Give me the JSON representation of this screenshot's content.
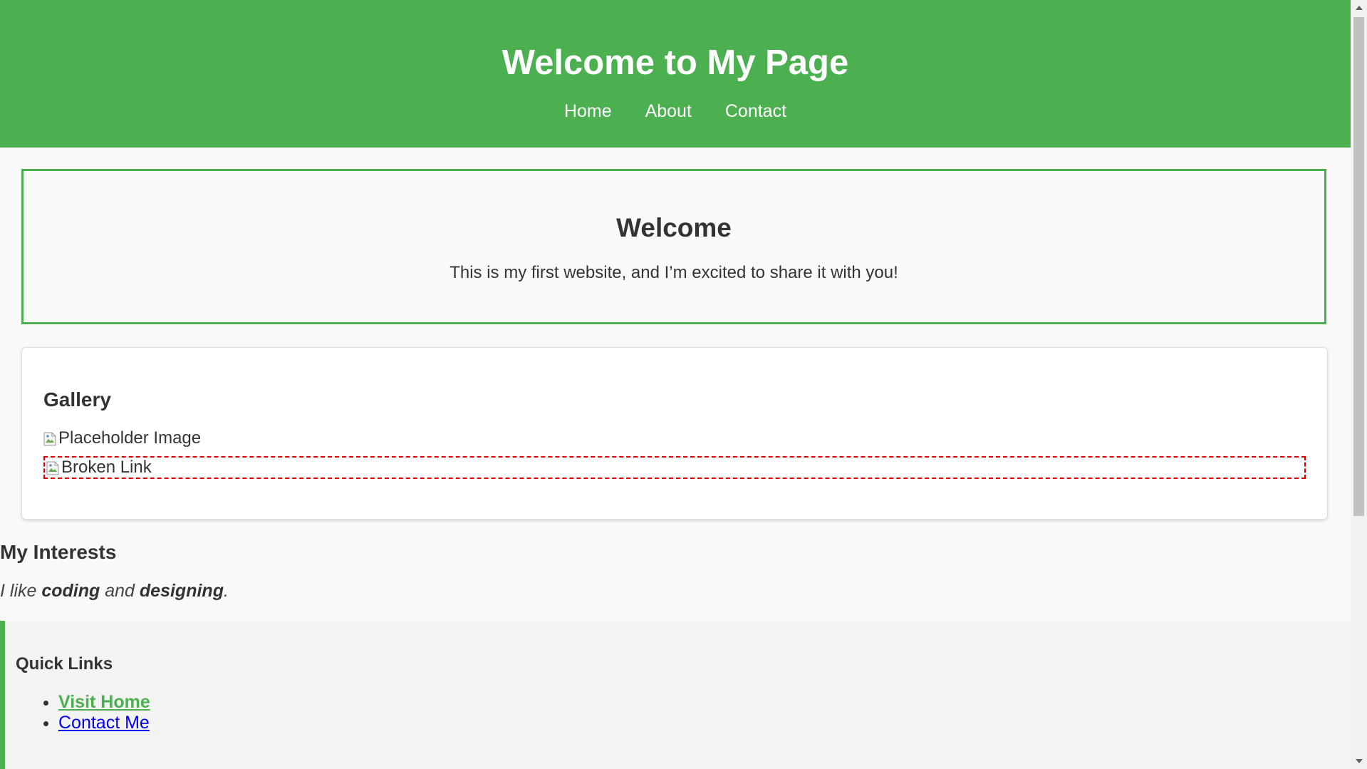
{
  "header": {
    "title": "Welcome to My Page",
    "background_color": "#4caf50",
    "nav": [
      {
        "label": "Home"
      },
      {
        "label": "About"
      },
      {
        "label": "Contact"
      }
    ]
  },
  "hero": {
    "heading": "Welcome",
    "text": "This is my first website, and I’m excited to share it with you!",
    "border_color": "#4caf50"
  },
  "gallery": {
    "heading": "Gallery",
    "images": [
      {
        "alt": "Placeholder Image",
        "state": "broken-image-icon"
      },
      {
        "alt": "Broken Link",
        "state": "broken-image-icon",
        "highlight_color": "#e00000"
      }
    ]
  },
  "interests": {
    "heading": "My Interests",
    "text_prefix": "I like ",
    "strong_1": "coding",
    "text_middle": " and ",
    "strong_2": "designing",
    "text_suffix": "."
  },
  "quick_links": {
    "heading": "Quick Links",
    "accent_color": "#4caf50",
    "links": [
      {
        "label": "Visit Home",
        "color": "#4caf50"
      },
      {
        "label": "Contact Me",
        "color": "#0000ee"
      }
    ]
  }
}
